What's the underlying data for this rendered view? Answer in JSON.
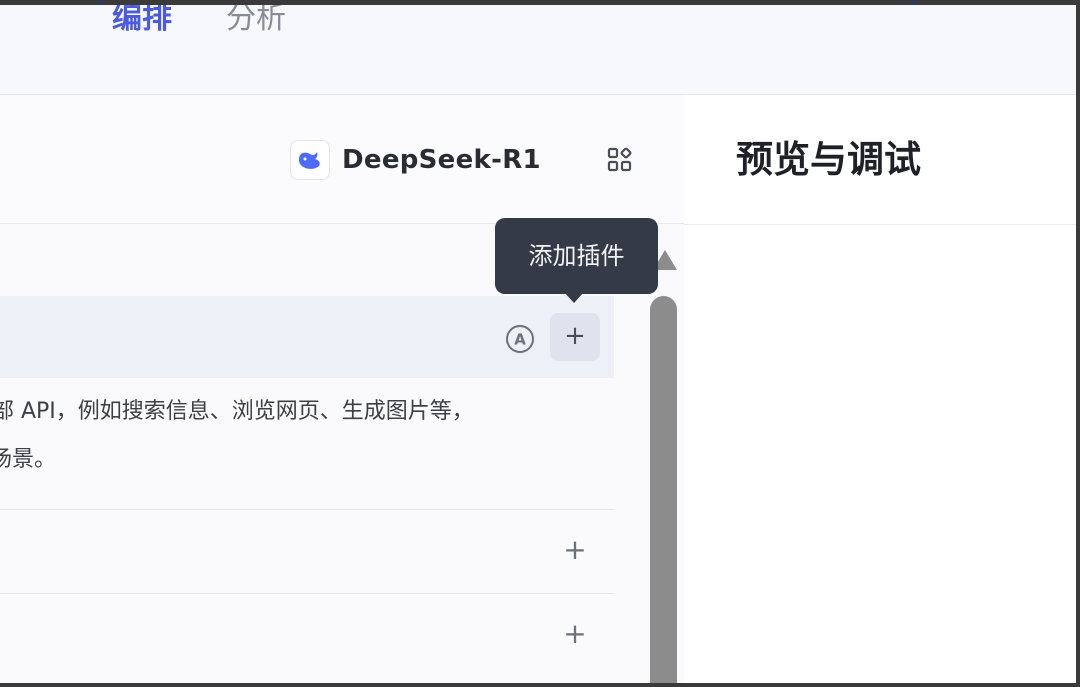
{
  "tabs": [
    {
      "label": "编排",
      "active": true
    },
    {
      "label": "分析",
      "active": false
    }
  ],
  "model": {
    "name": "DeepSeek-R1",
    "icon": "deepseek-whale-icon"
  },
  "grid_icon": "apps-grid-icon",
  "tooltip": {
    "text": "添加插件"
  },
  "plugins_section": {
    "auto_icon": "auto-a-icon",
    "add_label": "+",
    "description_lines": [
      "部 API，例如搜索信息、浏览网页、生成图片等，",
      "场景。"
    ]
  },
  "rows": [
    {
      "add_label": "+"
    },
    {
      "add_label": "+"
    }
  ],
  "preview": {
    "title": "预览与调试"
  },
  "colors": {
    "accent": "#4b5bdc",
    "tooltip_bg": "#353a47",
    "scrollbar": "#8c8c8c"
  }
}
